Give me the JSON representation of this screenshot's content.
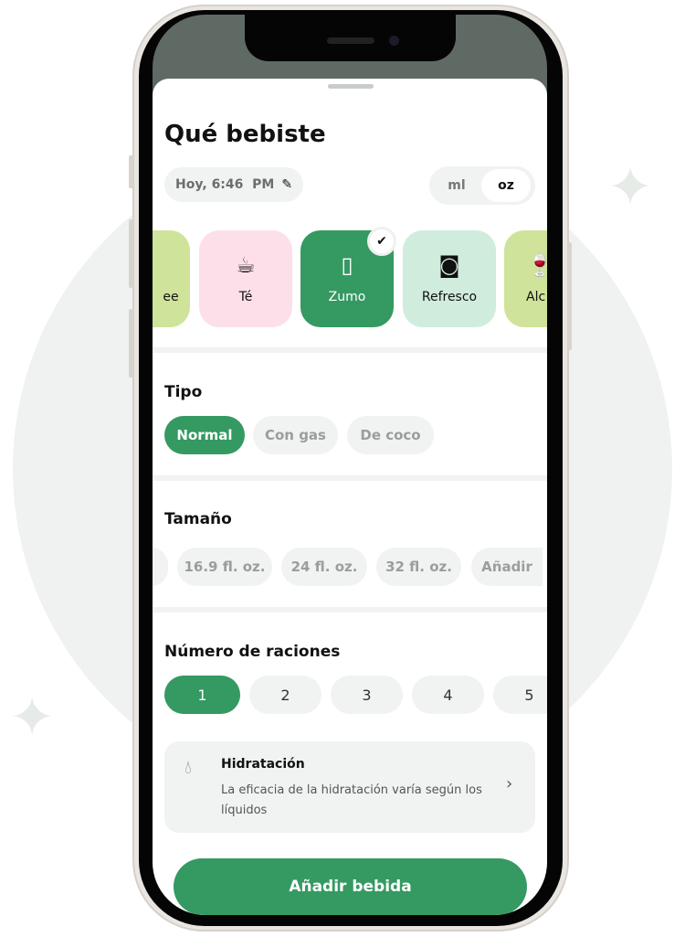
{
  "header": {
    "title": "Qué bebiste",
    "datetime": "Hoy, 6:46  PM",
    "edit_icon": "pencil-icon"
  },
  "units": {
    "options": [
      "ml",
      "oz"
    ],
    "selected": "oz"
  },
  "drinks": [
    {
      "label": "ee",
      "icon": "coffee-icon",
      "color": "#cfe39a"
    },
    {
      "label": "Té",
      "icon": "tea-cup-icon",
      "color": "#fddfea"
    },
    {
      "label": "Zumo",
      "icon": "juice-carton-icon",
      "color": "#359962",
      "selected": true
    },
    {
      "label": "Refresco",
      "icon": "soda-can-icon",
      "color": "#d0ecdd"
    },
    {
      "label": "Alc",
      "icon": "wine-glass-icon",
      "color": "#cfe39a"
    }
  ],
  "tipo": {
    "title": "Tipo",
    "options": [
      "Normal",
      "Con gas",
      "De coco"
    ],
    "selected": "Normal"
  },
  "tamano": {
    "title": "Tamaño",
    "options": [
      "16.9 fl. oz.",
      "24 fl. oz.",
      "32 fl. oz.",
      "Añadir"
    ]
  },
  "raciones": {
    "title": "Número de raciones",
    "options": [
      "1",
      "2",
      "3",
      "4",
      "5"
    ],
    "selected": "1"
  },
  "hydration": {
    "title": "Hidratación",
    "text": "La eficacia de la hidratación varía según los líquidos",
    "icon": "water-drop-icon"
  },
  "cta": {
    "label": "Añadir bebida"
  },
  "colors": {
    "accent": "#359962"
  }
}
